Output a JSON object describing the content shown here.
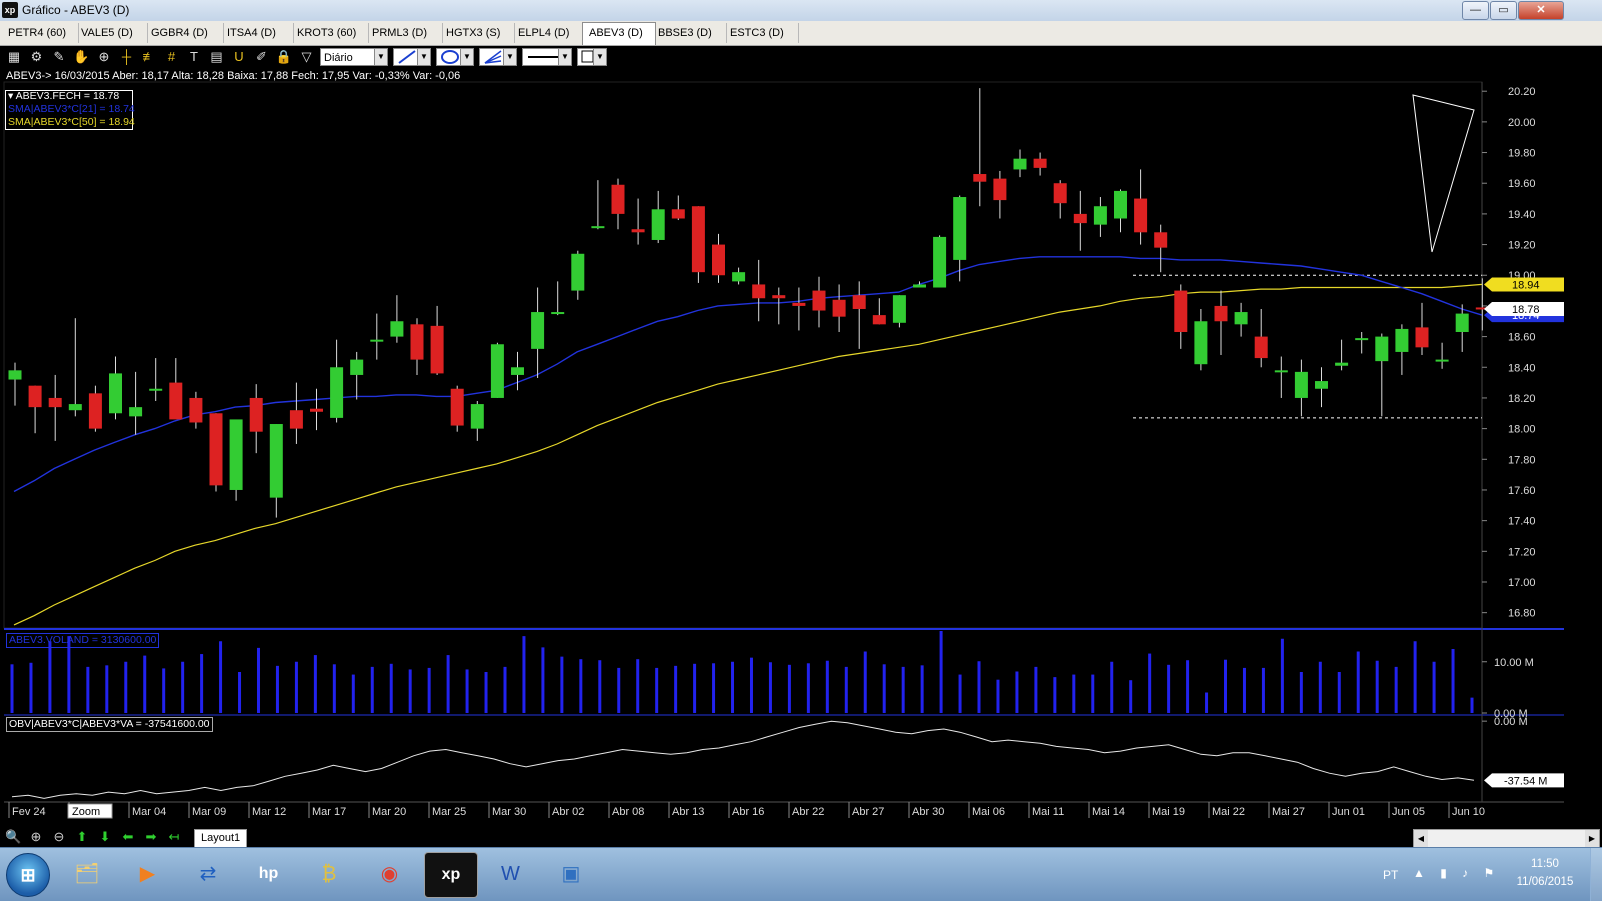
{
  "window": {
    "title": "Gráfico - ABEV3 (D)",
    "app_icon": "xp",
    "minimize": "—",
    "maximize": "▭",
    "close": "✕"
  },
  "tabs": [
    {
      "label": "PETR4 (60)"
    },
    {
      "label": "VALE5 (D)"
    },
    {
      "label": "GGBR4 (D)"
    },
    {
      "label": "ITSA4 (D)"
    },
    {
      "label": "KROT3 (60)"
    },
    {
      "label": "PRML3 (D)"
    },
    {
      "label": "HGTX3 (S)"
    },
    {
      "label": "ELPL4 (D)"
    },
    {
      "label": "ABEV3 (D)",
      "active": true
    },
    {
      "label": "BBSE3 (D)"
    },
    {
      "label": "ESTC3 (D)"
    }
  ],
  "toolbar": {
    "period": "Diário",
    "icons": [
      "chart-type-icon",
      "settings-icon",
      "pencil-icon",
      "hand-icon",
      "zoom-chart-icon",
      "crosshair-icon",
      "parallel-lines-icon",
      "hash-grid-icon",
      "text-tool-icon",
      "calculator-icon",
      "magnet-icon",
      "brush-icon",
      "lock-icon",
      "filter-icon"
    ]
  },
  "info_line": "ABEV3-> 16/03/2015 Aber: 18,17 Alta: 18,28 Baixa: 17,88 Fech: 17,95 Var: -0,33% Var: -0,06",
  "legends": {
    "close": "ABEV3.FECH = 18.78",
    "sma21": "SMA|ABEV3*C[21] = 18.74",
    "sma50": "SMA|ABEV3*C[50] = 18.94",
    "volume": "ABEV3.VOLAND = 3130600.00",
    "obv": "OBV|ABEV3*C|ABEV3*VA = -37541600.00"
  },
  "colors": {
    "up": "#33cc33",
    "down": "#dd2222",
    "sma21": "#2233dd",
    "sma50": "#e6d72a",
    "volume": "#2222ee",
    "obv": "#e8e8e8"
  },
  "price_axis": {
    "ticks": [
      "20.20",
      "20.00",
      "19.80",
      "19.60",
      "19.40",
      "19.20",
      "19.00",
      "18.80",
      "18.60",
      "18.40",
      "18.20",
      "18.00",
      "17.80",
      "17.60",
      "17.40",
      "17.20",
      "17.00",
      "16.80"
    ],
    "tick_values": [
      20.2,
      20.0,
      19.8,
      19.6,
      19.4,
      19.2,
      19.0,
      18.8,
      18.6,
      18.4,
      18.2,
      18.0,
      17.8,
      17.6,
      17.4,
      17.2,
      17.0,
      16.8
    ],
    "min": 16.7,
    "max": 20.26,
    "badge_sma50": "18.94",
    "badge_close": "18.78",
    "badge_sma21": "18.74"
  },
  "volume_axis": {
    "ticks": [
      "10.00 M",
      "0.00 M"
    ],
    "tick_values": [
      10,
      0
    ],
    "max": 15
  },
  "obv_axis": {
    "ticks": [
      "0.00 M",
      "-37.54 M"
    ],
    "tick_values": [
      0,
      -37.54
    ],
    "min": -50,
    "max": 2
  },
  "date_axis": {
    "labels": [
      "Fev 24",
      "Zoom",
      "Mar 04",
      "Mar 09",
      "Mar 12",
      "Mar 17",
      "Mar 20",
      "Mar 25",
      "Mar 30",
      "Abr 02",
      "Abr 08",
      "Abr 13",
      "Abr 16",
      "Abr 22",
      "Abr 27",
      "Abr 30",
      "Mai 06",
      "Mai 11",
      "Mai 14",
      "Mai 19",
      "Mai 22",
      "Mai 27",
      "Jun 01",
      "Jun 05",
      "Jun 10"
    ]
  },
  "bottom": {
    "layout_tab": "Layout1",
    "zoom_icons": [
      "zoom-icon",
      "zoom-in-icon",
      "zoom-out-icon",
      "up-arrow-icon",
      "down-arrow-icon",
      "left-arrow-icon",
      "right-arrow-icon",
      "back-arrow-icon"
    ]
  },
  "taskbar": {
    "language": "PT",
    "time": "11:50",
    "date": "11/06/2015",
    "apps": [
      "explorer-icon",
      "media-player-icon",
      "network-icon",
      "hp-icon",
      "finance-icon",
      "chrome-icon",
      "xp-icon",
      "word-icon",
      "image-viewer-icon"
    ]
  },
  "chart_data": {
    "type": "candlestick",
    "symbol": "ABEV3",
    "period": "Diário",
    "support_level": 18.07,
    "resistance_level": 19.0,
    "candles": [
      {
        "o": 18.32,
        "h": 18.43,
        "l": 18.15,
        "c": 18.38
      },
      {
        "o": 18.28,
        "h": 18.28,
        "l": 17.97,
        "c": 18.14
      },
      {
        "o": 18.2,
        "h": 18.35,
        "l": 17.92,
        "c": 18.14
      },
      {
        "o": 18.12,
        "h": 18.72,
        "l": 18.08,
        "c": 18.16
      },
      {
        "o": 18.23,
        "h": 18.28,
        "l": 17.98,
        "c": 18.0
      },
      {
        "o": 18.1,
        "h": 18.47,
        "l": 18.06,
        "c": 18.36
      },
      {
        "o": 18.08,
        "h": 18.37,
        "l": 17.96,
        "c": 18.14
      },
      {
        "o": 18.26,
        "h": 18.46,
        "l": 18.18,
        "c": 18.26
      },
      {
        "o": 18.3,
        "h": 18.46,
        "l": 18.1,
        "c": 18.06
      },
      {
        "o": 18.2,
        "h": 18.24,
        "l": 18.0,
        "c": 18.04
      },
      {
        "o": 18.1,
        "h": 18.1,
        "l": 17.59,
        "c": 17.63
      },
      {
        "o": 17.6,
        "h": 18.05,
        "l": 17.53,
        "c": 18.06
      },
      {
        "o": 18.2,
        "h": 18.29,
        "l": 17.84,
        "c": 17.98
      },
      {
        "o": 17.55,
        "h": 18.03,
        "l": 17.42,
        "c": 18.03
      },
      {
        "o": 18.12,
        "h": 18.3,
        "l": 17.9,
        "c": 18.0
      },
      {
        "o": 18.13,
        "h": 18.26,
        "l": 17.99,
        "c": 18.11
      },
      {
        "o": 18.07,
        "h": 18.58,
        "l": 18.04,
        "c": 18.4
      },
      {
        "o": 18.35,
        "h": 18.5,
        "l": 18.19,
        "c": 18.45
      },
      {
        "o": 18.58,
        "h": 18.75,
        "l": 18.45,
        "c": 18.58
      },
      {
        "o": 18.6,
        "h": 18.87,
        "l": 18.56,
        "c": 18.7
      },
      {
        "o": 18.68,
        "h": 18.72,
        "l": 18.35,
        "c": 18.45
      },
      {
        "o": 18.67,
        "h": 18.8,
        "l": 18.35,
        "c": 18.36
      },
      {
        "o": 18.26,
        "h": 18.28,
        "l": 17.98,
        "c": 18.02
      },
      {
        "o": 18.0,
        "h": 18.18,
        "l": 17.92,
        "c": 18.16
      },
      {
        "o": 18.2,
        "h": 18.56,
        "l": 18.2,
        "c": 18.55
      },
      {
        "o": 18.35,
        "h": 18.5,
        "l": 18.25,
        "c": 18.4
      },
      {
        "o": 18.52,
        "h": 18.92,
        "l": 18.33,
        "c": 18.76
      },
      {
        "o": 18.76,
        "h": 18.96,
        "l": 18.74,
        "c": 18.76
      },
      {
        "o": 18.9,
        "h": 19.16,
        "l": 18.84,
        "c": 19.14
      },
      {
        "o": 19.32,
        "h": 19.62,
        "l": 19.3,
        "c": 19.32
      },
      {
        "o": 19.59,
        "h": 19.63,
        "l": 19.3,
        "c": 19.4
      },
      {
        "o": 19.3,
        "h": 19.5,
        "l": 19.2,
        "c": 19.28
      },
      {
        "o": 19.23,
        "h": 19.55,
        "l": 19.21,
        "c": 19.43
      },
      {
        "o": 19.43,
        "h": 19.52,
        "l": 19.36,
        "c": 19.37
      },
      {
        "o": 19.45,
        "h": 19.45,
        "l": 18.95,
        "c": 19.02
      },
      {
        "o": 19.2,
        "h": 19.27,
        "l": 18.95,
        "c": 19.0
      },
      {
        "o": 18.96,
        "h": 19.05,
        "l": 18.94,
        "c": 19.02
      },
      {
        "o": 18.94,
        "h": 19.1,
        "l": 18.7,
        "c": 18.85
      },
      {
        "o": 18.87,
        "h": 18.92,
        "l": 18.68,
        "c": 18.85
      },
      {
        "o": 18.82,
        "h": 18.92,
        "l": 18.64,
        "c": 18.8
      },
      {
        "o": 18.9,
        "h": 18.99,
        "l": 18.66,
        "c": 18.77
      },
      {
        "o": 18.84,
        "h": 18.94,
        "l": 18.63,
        "c": 18.73
      },
      {
        "o": 18.87,
        "h": 18.96,
        "l": 18.52,
        "c": 18.78
      },
      {
        "o": 18.74,
        "h": 18.85,
        "l": 18.68,
        "c": 18.68
      },
      {
        "o": 18.69,
        "h": 18.87,
        "l": 18.66,
        "c": 18.87
      },
      {
        "o": 18.92,
        "h": 18.96,
        "l": 18.92,
        "c": 18.94
      },
      {
        "o": 18.92,
        "h": 19.26,
        "l": 18.94,
        "c": 19.25
      },
      {
        "o": 19.1,
        "h": 19.52,
        "l": 18.96,
        "c": 19.51
      },
      {
        "o": 19.66,
        "h": 20.22,
        "l": 19.45,
        "c": 19.61
      },
      {
        "o": 19.63,
        "h": 19.68,
        "l": 19.37,
        "c": 19.49
      },
      {
        "o": 19.69,
        "h": 19.82,
        "l": 19.64,
        "c": 19.76
      },
      {
        "o": 19.76,
        "h": 19.8,
        "l": 19.65,
        "c": 19.7
      },
      {
        "o": 19.6,
        "h": 19.62,
        "l": 19.37,
        "c": 19.47
      },
      {
        "o": 19.4,
        "h": 19.55,
        "l": 19.16,
        "c": 19.34
      },
      {
        "o": 19.33,
        "h": 19.51,
        "l": 19.25,
        "c": 19.45
      },
      {
        "o": 19.37,
        "h": 19.56,
        "l": 19.28,
        "c": 19.55
      },
      {
        "o": 19.5,
        "h": 19.69,
        "l": 19.2,
        "c": 19.28
      },
      {
        "o": 19.28,
        "h": 19.33,
        "l": 19.02,
        "c": 19.18
      },
      {
        "o": 18.9,
        "h": 18.94,
        "l": 18.52,
        "c": 18.63
      },
      {
        "o": 18.42,
        "h": 18.78,
        "l": 18.38,
        "c": 18.7
      },
      {
        "o": 18.8,
        "h": 18.9,
        "l": 18.48,
        "c": 18.7
      },
      {
        "o": 18.68,
        "h": 18.82,
        "l": 18.6,
        "c": 18.76
      },
      {
        "o": 18.6,
        "h": 18.78,
        "l": 18.4,
        "c": 18.46
      },
      {
        "o": 18.38,
        "h": 18.47,
        "l": 18.2,
        "c": 18.38
      },
      {
        "o": 18.2,
        "h": 18.45,
        "l": 18.08,
        "c": 18.37
      },
      {
        "o": 18.26,
        "h": 18.4,
        "l": 18.14,
        "c": 18.31
      },
      {
        "o": 18.41,
        "h": 18.58,
        "l": 18.38,
        "c": 18.43
      },
      {
        "o": 18.59,
        "h": 18.63,
        "l": 18.49,
        "c": 18.59
      },
      {
        "o": 18.44,
        "h": 18.62,
        "l": 18.08,
        "c": 18.6
      },
      {
        "o": 18.5,
        "h": 18.68,
        "l": 18.35,
        "c": 18.65
      },
      {
        "o": 18.66,
        "h": 18.82,
        "l": 18.48,
        "c": 18.53
      },
      {
        "o": 18.44,
        "h": 18.56,
        "l": 18.39,
        "c": 18.45
      },
      {
        "o": 18.63,
        "h": 18.81,
        "l": 18.5,
        "c": 18.75
      },
      {
        "o": 18.79,
        "h": 18.98,
        "l": 18.64,
        "c": 18.78
      }
    ],
    "sma21": [
      17.59,
      17.66,
      17.74,
      17.8,
      17.86,
      17.91,
      17.96,
      18.0,
      18.05,
      18.09,
      18.11,
      18.14,
      18.15,
      18.17,
      18.18,
      18.19,
      18.2,
      18.21,
      18.21,
      18.22,
      18.22,
      18.21,
      18.21,
      18.23,
      18.25,
      18.3,
      18.35,
      18.42,
      18.5,
      18.55,
      18.6,
      18.65,
      18.7,
      18.73,
      18.77,
      18.8,
      18.81,
      18.82,
      18.82,
      18.83,
      18.85,
      18.86,
      18.87,
      18.88,
      18.89,
      18.94,
      18.98,
      19.03,
      19.07,
      19.09,
      19.11,
      19.12,
      19.12,
      19.12,
      19.12,
      19.12,
      19.11,
      19.11,
      19.1,
      19.1,
      19.1,
      19.09,
      19.08,
      19.07,
      19.06,
      19.04,
      19.02,
      19.0,
      18.96,
      18.92,
      18.88,
      18.83,
      18.78,
      18.74
    ],
    "sma50": [
      16.72,
      16.78,
      16.85,
      16.91,
      16.97,
      17.03,
      17.09,
      17.14,
      17.2,
      17.24,
      17.27,
      17.31,
      17.35,
      17.38,
      17.42,
      17.46,
      17.5,
      17.54,
      17.58,
      17.62,
      17.65,
      17.68,
      17.71,
      17.74,
      17.77,
      17.81,
      17.85,
      17.9,
      17.96,
      18.02,
      18.07,
      18.12,
      18.17,
      18.21,
      18.25,
      18.29,
      18.32,
      18.35,
      18.38,
      18.41,
      18.44,
      18.47,
      18.49,
      18.51,
      18.53,
      18.55,
      18.58,
      18.61,
      18.64,
      18.67,
      18.7,
      18.73,
      18.76,
      18.78,
      18.8,
      18.83,
      18.85,
      18.86,
      18.88,
      18.89,
      18.89,
      18.9,
      18.91,
      18.91,
      18.92,
      18.92,
      18.92,
      18.92,
      18.92,
      18.92,
      18.92,
      18.92,
      18.93,
      18.94
    ],
    "volume": [
      9.5,
      9.8,
      14.0,
      15.0,
      9.0,
      9.3,
      10.0,
      11.2,
      8.7,
      10.0,
      11.5,
      14.0,
      8.0,
      12.7,
      9.2,
      10.0,
      11.3,
      9.5,
      7.5,
      9.0,
      9.6,
      8.5,
      8.8,
      11.3,
      8.5,
      8.0,
      9.0,
      15.0,
      12.8,
      11.0,
      10.5,
      10.3,
      8.8,
      10.5,
      8.8,
      9.2,
      9.6,
      9.7,
      10.0,
      10.8,
      9.9,
      9.4,
      9.7,
      10.2,
      9.0,
      12.0,
      9.5,
      9.0,
      9.3,
      16.0,
      7.5,
      10.1,
      6.5,
      8.1,
      9.0,
      7.0,
      7.5,
      7.5,
      10.0,
      6.4,
      11.6,
      9.4,
      10.3,
      4.0,
      10.4,
      8.8,
      8.8,
      14.5,
      8.0,
      10.0,
      8.0,
      12.0,
      10.2,
      9.0,
      14.0,
      10.0,
      12.5,
      3.0
    ],
    "obv": [
      -48,
      -47,
      -49,
      -47,
      -46,
      -47,
      -45,
      -46,
      -44,
      -46,
      -45,
      -44,
      -42,
      -44,
      -42,
      -41,
      -38,
      -35,
      -33,
      -31,
      -28,
      -30,
      -32,
      -30,
      -26,
      -22,
      -19,
      -18,
      -20,
      -22,
      -24,
      -27,
      -29,
      -27,
      -25,
      -24,
      -22,
      -20,
      -18,
      -19,
      -20,
      -21,
      -20,
      -18,
      -17,
      -15,
      -13,
      -10,
      -7,
      -4,
      -2,
      0,
      -1,
      -3,
      -5,
      -7,
      -8,
      -6,
      -5,
      -7,
      -10,
      -13,
      -12,
      -13,
      -14,
      -16,
      -17,
      -18,
      -20,
      -19,
      -17,
      -16,
      -15,
      -18,
      -21,
      -22,
      -20,
      -20,
      -22,
      -24,
      -26,
      -30,
      -33,
      -35,
      -33,
      -32,
      -29,
      -32,
      -35,
      -37,
      -36,
      -37.5
    ]
  }
}
